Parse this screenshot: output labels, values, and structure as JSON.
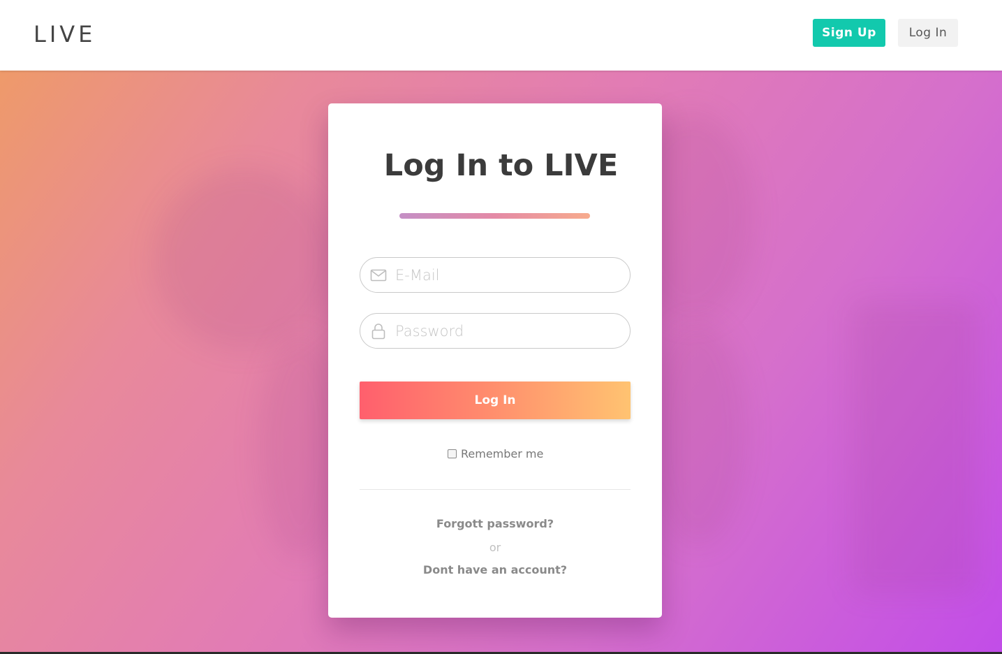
{
  "header": {
    "logo": "LIVE",
    "signup_label": "Sign Up",
    "login_label": "Log In"
  },
  "login_card": {
    "title": "Log In to LIVE",
    "email": {
      "placeholder": "E-Mail",
      "value": "",
      "icon": "envelope-icon"
    },
    "password": {
      "placeholder": "Password",
      "value": "",
      "icon": "lock-icon"
    },
    "submit_label": "Log In",
    "remember_label": "Remember me",
    "remember_checked": false,
    "forgot_label": "Forgott password?",
    "or_label": "or",
    "signup_prompt": "Dont have an account?"
  },
  "colors": {
    "signup_button": "#12c9ad",
    "login_gradient_start": "#ff5f6d",
    "login_gradient_end": "#ffc371",
    "background_gradient_start": "#ee9a6a",
    "background_gradient_end": "#c24de8"
  }
}
